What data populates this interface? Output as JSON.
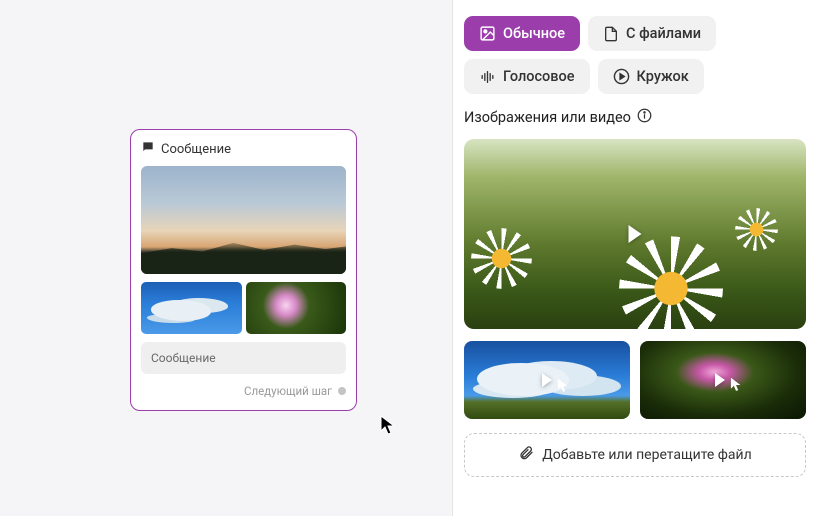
{
  "preview": {
    "title": "Сообщение",
    "input_placeholder": "Сообщение",
    "next_step_label": "Следующий шаг"
  },
  "tabs": {
    "normal": "Обычное",
    "with_files": "С файлами",
    "voice": "Голосовое",
    "circle": "Кружок"
  },
  "media_section": {
    "label": "Изображения или видео"
  },
  "dropzone": {
    "label": "Добавьте или перетащите файл"
  },
  "colors": {
    "accent": "#9b3eac"
  }
}
